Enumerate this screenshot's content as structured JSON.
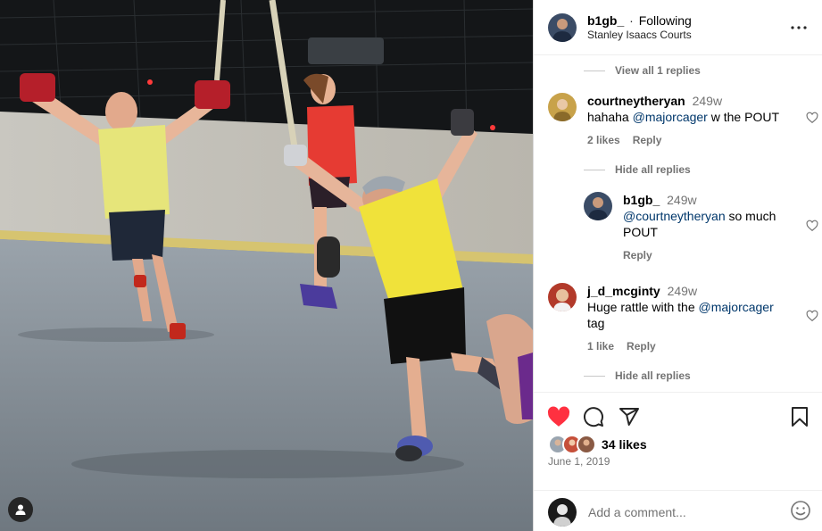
{
  "post": {
    "username": "b1gb_",
    "separator": "·",
    "follow_status": "Following",
    "location": "Stanley Isaacs Courts"
  },
  "thread": {
    "view_replies_top": "View all 1 replies",
    "comment1": {
      "username": "courtneytheryan",
      "time": "249w",
      "text_before": "hahaha",
      "mention": "@majorcager",
      "text_after": "w the POUT",
      "likes": "2 likes",
      "reply": "Reply"
    },
    "hide_replies_1": "Hide all replies",
    "reply1": {
      "username": "b1gb_",
      "time": "249w",
      "mention": "@courtneytheryan",
      "text_after": "so much",
      "text_line2": "POUT",
      "reply": "Reply"
    },
    "comment2": {
      "username": "j_d_mcginty",
      "time": "249w",
      "text_before": "Huge rattle with the",
      "mention": "@majorcager",
      "text_line2": "tag",
      "likes": "1 like",
      "reply": "Reply"
    },
    "hide_replies_2": "Hide all replies"
  },
  "actions": {
    "likes_count": "34 likes",
    "date": "June 1, 2019",
    "comment_placeholder": "Add a comment...",
    "like_color": "#ff3040"
  },
  "icons": [
    "more-icon",
    "heart-filled-icon",
    "comment-icon",
    "share-icon",
    "bookmark-icon",
    "heart-outline-icon",
    "emoji-icon",
    "user-tag-icon"
  ]
}
